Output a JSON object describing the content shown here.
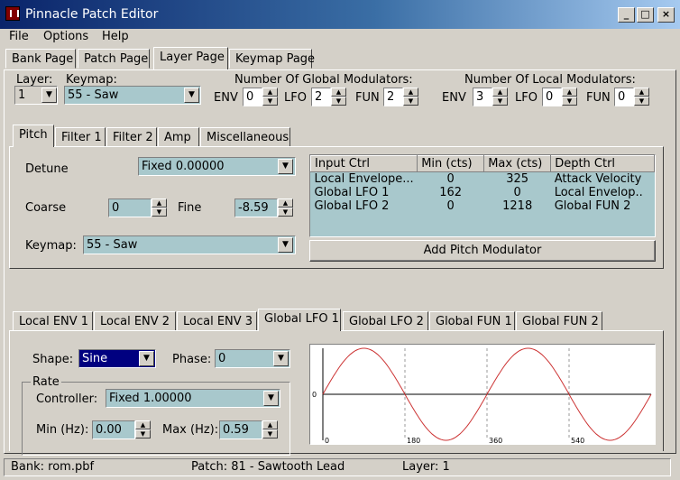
{
  "window": {
    "title": "Pinnacle Patch Editor"
  },
  "menu": {
    "file": "File",
    "options": "Options",
    "help": "Help"
  },
  "main_tabs": [
    "Bank Page",
    "Patch Page",
    "Layer Page",
    "Keymap Page"
  ],
  "layer": {
    "label": "Layer:",
    "value": "1"
  },
  "keymap": {
    "label": "Keymap:",
    "value": "55 - Saw"
  },
  "global_mods": {
    "label": "Number Of Global Modulators:",
    "env_label": "ENV",
    "env": "0",
    "lfo_label": "LFO",
    "lfo": "2",
    "fun_label": "FUN",
    "fun": "2"
  },
  "local_mods": {
    "label": "Number Of Local Modulators:",
    "env_label": "ENV",
    "env": "3",
    "lfo_label": "LFO",
    "lfo": "0",
    "fun_label": "FUN",
    "fun": "0"
  },
  "sub_tabs": [
    "Pitch",
    "Filter 1",
    "Filter 2",
    "Amp",
    "Miscellaneous"
  ],
  "pitch": {
    "detune_label": "Detune",
    "detune_value": "Fixed 0.00000",
    "coarse_label": "Coarse",
    "coarse_value": "0",
    "fine_label": "Fine",
    "fine_value": "-8.59",
    "keymap_label": "Keymap:",
    "keymap_value": "55 - Saw",
    "table_headers": [
      "Input Ctrl",
      "Min (cts)",
      "Max (cts)",
      "Depth Ctrl"
    ],
    "table_rows": [
      [
        "Local Envelope...",
        "0",
        "325",
        "Attack Velocity"
      ],
      [
        "Global LFO 1",
        "162",
        "0",
        "Local Envelop.."
      ],
      [
        "Global LFO 2",
        "0",
        "1218",
        "Global FUN 2"
      ]
    ],
    "add_button": "Add Pitch Modulator"
  },
  "mod_tabs": [
    "Local ENV 1",
    "Local ENV 2",
    "Local ENV 3",
    "Global LFO 1",
    "Global LFO 2",
    "Global FUN 1",
    "Global FUN 2"
  ],
  "lfo": {
    "shape_label": "Shape:",
    "shape_value": "Sine",
    "phase_label": "Phase:",
    "phase_value": "0",
    "rate_group": "Rate",
    "controller_label": "Controller:",
    "controller_value": "Fixed 1.00000",
    "min_label": "Min (Hz):",
    "min_value": "0.00",
    "max_label": "Max (Hz):",
    "max_value": "0.59"
  },
  "chart_data": {
    "type": "line",
    "series": [
      {
        "values_description_free": true,
        "cycles": 2
      }
    ],
    "x_ticks": [
      "0",
      "180",
      "360",
      "540"
    ],
    "y_ticks": [
      "0"
    ],
    "xlim": [
      0,
      720
    ],
    "ylim": [
      -1,
      1
    ],
    "colors": {
      "wave": "#cc3333",
      "grid": "#999999"
    }
  },
  "status": {
    "bank": "Bank: rom.pbf",
    "patch": "Patch: 81 - Sawtooth Lead",
    "layer": "Layer: 1"
  },
  "colors": {
    "title_start": "#0a246a",
    "field": "#a8c8cc",
    "selected": "#000080"
  }
}
